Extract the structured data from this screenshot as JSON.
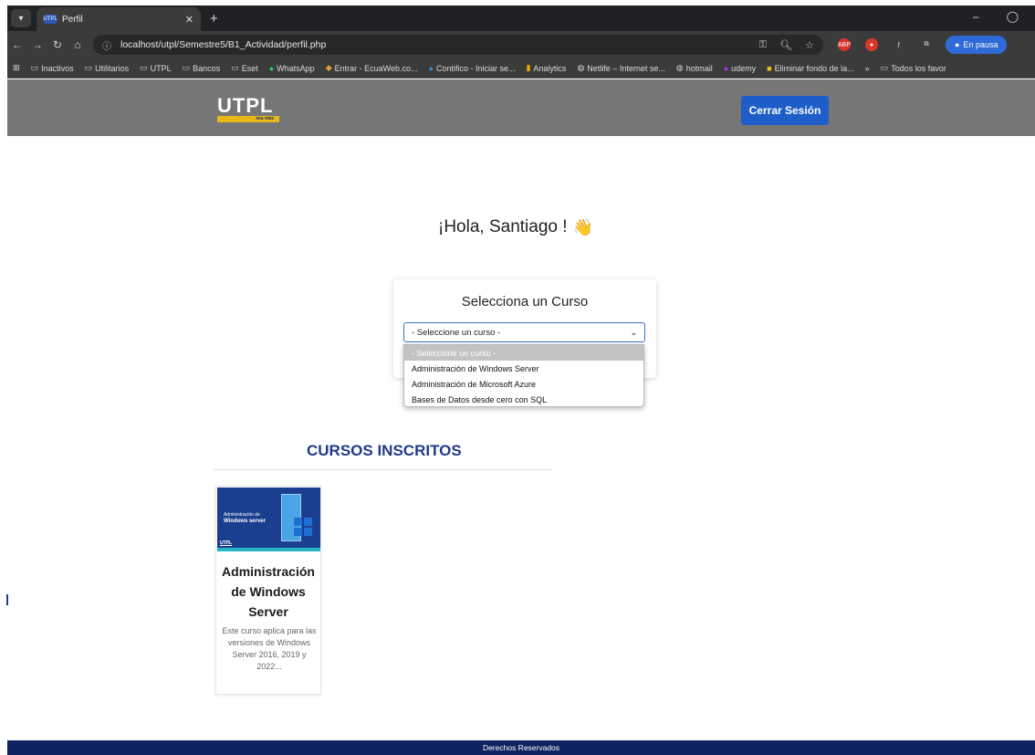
{
  "browser": {
    "tab_title": "Perfil",
    "tab_favicon": "UTPL",
    "url": "localhost/utpl/Semestre5/B1_Actividad/perfil.php",
    "paused_label": "En pausa",
    "bookmarks": [
      "Inactivos",
      "Utilitarios",
      "UTPL",
      "Bancos",
      "Eset",
      "WhatsApp",
      "Entrar - EcuaWeb.co...",
      "Contifico - Iniciar se...",
      "Analytics",
      "Netlife – Internet se...",
      "hotmail",
      "udemy",
      "Eliminar fondo de la...",
      "»",
      "Todos los favor"
    ]
  },
  "header": {
    "logo_text": "UTPL",
    "logo_tagline": "sea más",
    "logout_label": "Cerrar Sesión"
  },
  "greeting": {
    "text": "¡Hola, Santiago !",
    "emoji": "👋"
  },
  "course_select": {
    "title": "Selecciona un Curso",
    "selected": "- Seleccione un curso -",
    "options": [
      "- Seleccione un curso -",
      "Administración de Windows Server",
      "Administración de Microsoft Azure",
      "Bases de Datos desde cero con SQL"
    ]
  },
  "enrolled": {
    "title": "CURSOS INSCRITOS",
    "courses": [
      {
        "thumb_line1": "Administración de",
        "thumb_line2": "Windows server",
        "thumb_brand": "UTPL",
        "title": "Administración de Windows Server",
        "description": "Este curso aplica para las versiones de Windows Server 2016, 2019 y 2022..."
      }
    ]
  },
  "footer": {
    "text": "Derechos Reservados"
  },
  "colors": {
    "header_bg": "#767676",
    "button_blue": "#1f5ec8",
    "title_blue": "#1f3b86",
    "footer_bg": "#0d2361"
  }
}
